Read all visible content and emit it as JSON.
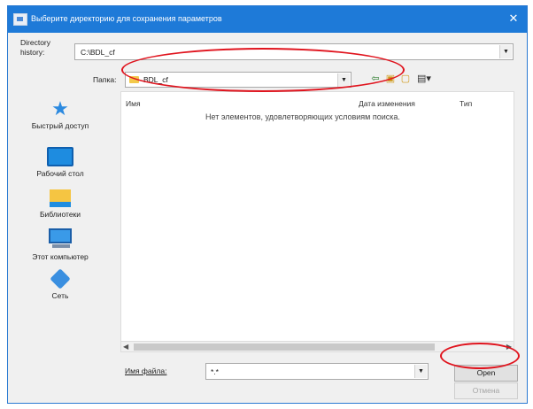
{
  "window": {
    "title": "Выберите директорию для сохранения параметров",
    "close_glyph": "✕"
  },
  "history": {
    "label_line1": "Directory",
    "label_line2": "history:",
    "value": "C:\\BDL_cf"
  },
  "folder": {
    "label": "Папка:",
    "value": "BDL_cf"
  },
  "toolbar": {
    "back_icon": "back-arrow-icon",
    "up_icon": "up-folder-icon",
    "new_folder_icon": "new-folder-icon",
    "view_icon": "view-menu-icon"
  },
  "places": [
    {
      "label": "Быстрый доступ",
      "icon": "star-icon"
    },
    {
      "label": "Рабочий стол",
      "icon": "desktop-icon"
    },
    {
      "label": "Библиотеки",
      "icon": "libraries-icon"
    },
    {
      "label": "Этот компьютер",
      "icon": "computer-icon"
    },
    {
      "label": "Сеть",
      "icon": "network-icon"
    }
  ],
  "file_list": {
    "columns": [
      "Имя",
      "Дата изменения",
      "Тип"
    ],
    "empty_message": "Нет элементов, удовлетворяющих условиям поиска."
  },
  "file_name": {
    "label": "Имя файла:",
    "value": "*.*"
  },
  "buttons": {
    "open": "Open",
    "cancel": "Отмена"
  },
  "annotation_color": "#e0141e"
}
